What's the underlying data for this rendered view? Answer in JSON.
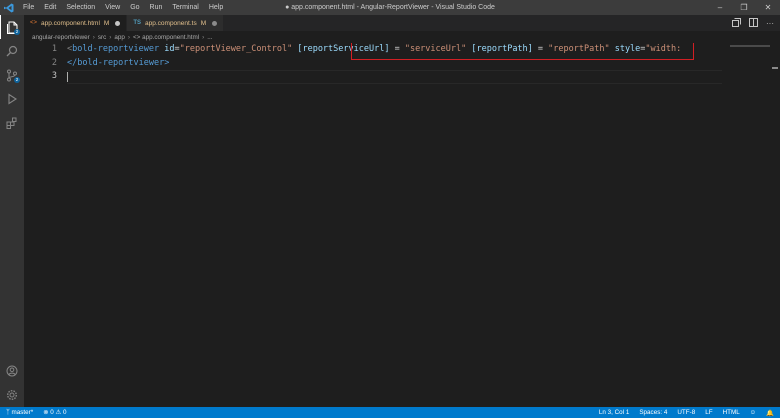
{
  "window": {
    "title": "● app.component.html - Angular-ReportViewer - Visual Studio Code",
    "menu": [
      "File",
      "Edit",
      "Selection",
      "View",
      "Go",
      "Run",
      "Terminal",
      "Help"
    ]
  },
  "tabs": [
    {
      "icon": "<>",
      "label": "app.component.html",
      "status": "M",
      "active": true
    },
    {
      "icon": "TS",
      "label": "app.component.ts",
      "status": "M",
      "active": false
    }
  ],
  "breadcrumb": [
    "angular-reportviewer",
    "src",
    "app",
    "<> app.component.html",
    "..."
  ],
  "editor": {
    "lines": [
      {
        "number": "1",
        "tokens": {
          "open": "<",
          "tag": "bold-reportviewer",
          "sp1": " ",
          "id_attr": "id",
          "id_eq": "=",
          "id_val": "\"reportViewer_Control\"",
          "sp2": " ",
          "a1": "[reportServiceUrl]",
          "a1_eq": " = ",
          "a1_val": "\"serviceUrl\"",
          "sp3": " ",
          "a2": "[reportPath]",
          "a2_eq": " = ",
          "a2_val": "\"reportPath\"",
          "sp4": " ",
          "a3": "style",
          "a3_eq": "=",
          "a3_val": "\"width:"
        }
      },
      {
        "number": "2",
        "close": "</bold-reportviewer>"
      },
      {
        "number": "3"
      }
    ]
  },
  "statusbar": {
    "branch": "master*",
    "errors": "0",
    "warnings": "0",
    "position": "Ln 3, Col 1",
    "spaces": "Spaces: 4",
    "encoding": "UTF-8",
    "eol": "LF",
    "language": "HTML"
  },
  "activity": {
    "explorer_badge": "2",
    "scm_badge": "2"
  }
}
